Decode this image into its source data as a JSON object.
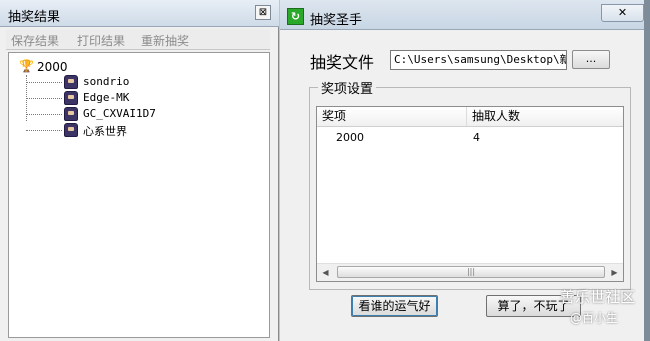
{
  "left_window": {
    "title": "抽奖结果",
    "close_label": "⊠",
    "toolbar": [
      "保存结果",
      "打印结果",
      "重新抽奖"
    ],
    "tree": {
      "root": "2000",
      "children": [
        "sondrio",
        "Edge-MK",
        "GC_CXVAI1D7",
        "心系世界"
      ]
    }
  },
  "right_window": {
    "title": "抽奖圣手",
    "close_label": "✕",
    "file_label": "抽奖文件",
    "file_path": "C:\\Users\\samsung\\Desktop\\新建",
    "browse_label": "...",
    "prize_group_title": "奖项设置",
    "columns": [
      "奖项",
      "抽取人数"
    ],
    "rows": [
      {
        "prize": "2000",
        "count": "4"
      }
    ],
    "luck_button": "看谁的运气好",
    "quit_button": "算了，不玩了"
  },
  "watermark": {
    "main": "善乐世社区",
    "sub": "@百小生"
  },
  "colors": {
    "desktop": "#b9c7d4",
    "window_bg": "#f0f0f0",
    "app_icon": "#2aa82a"
  }
}
